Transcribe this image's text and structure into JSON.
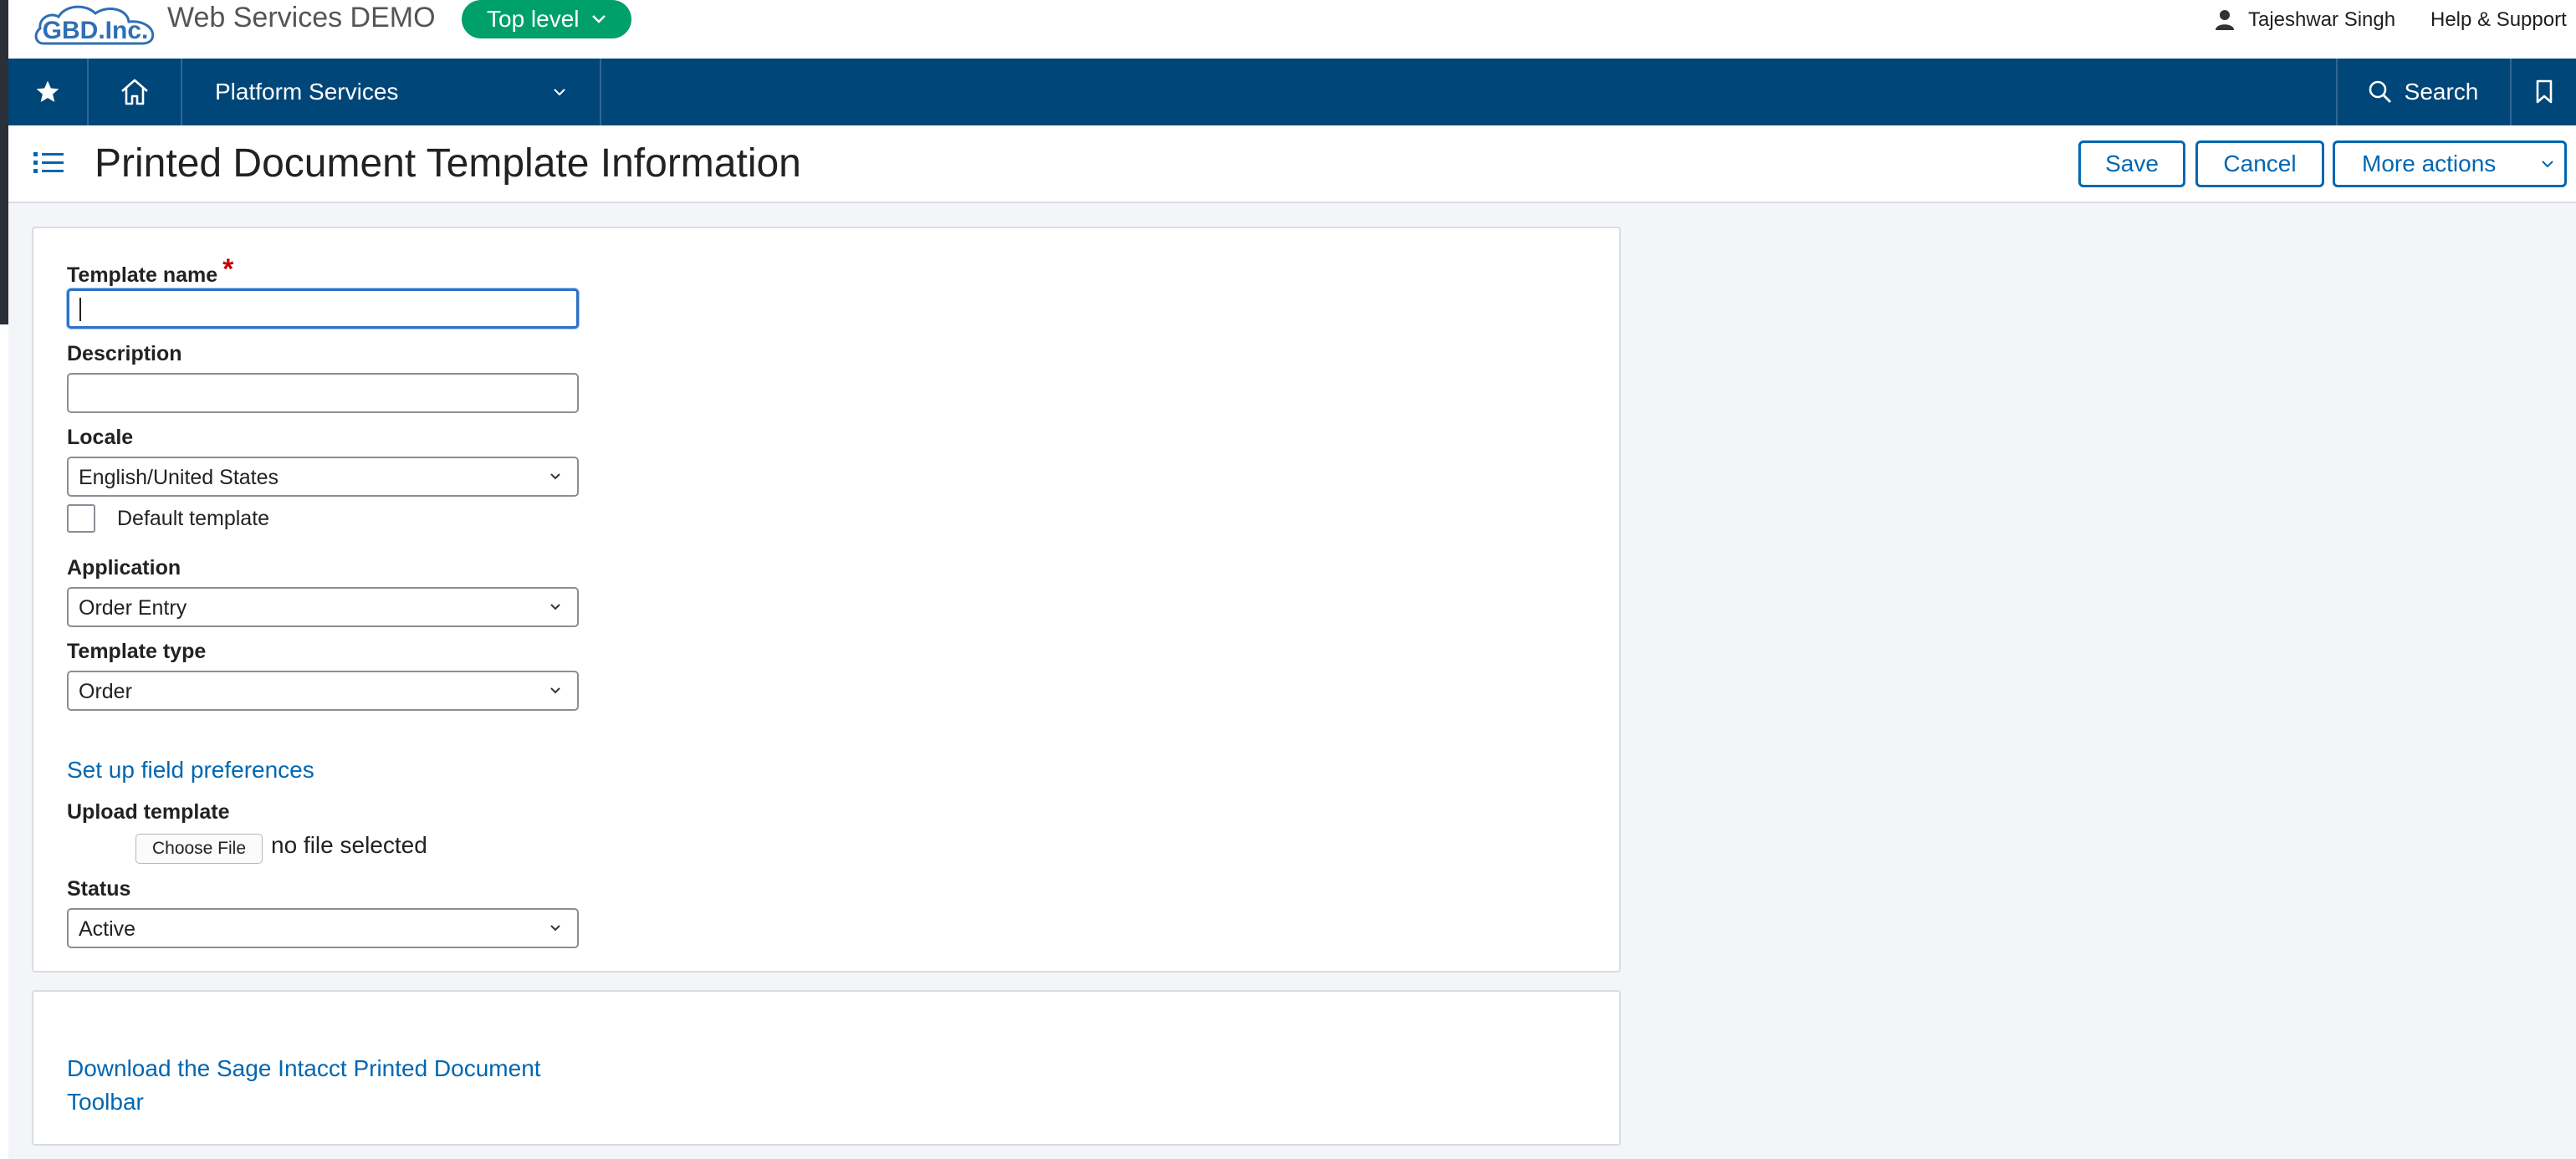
{
  "topbar": {
    "logo_text": "GBD.Inc.",
    "company_name": "Web Services DEMO",
    "level_label": "Top level",
    "user_name": "Tajeshwar Singh",
    "help_label": "Help & Support"
  },
  "nav": {
    "platform_label": "Platform Services",
    "search_label": "Search"
  },
  "header": {
    "title": "Printed Document Template Information",
    "save_label": "Save",
    "cancel_label": "Cancel",
    "more_actions_label": "More actions"
  },
  "form": {
    "template_name": {
      "label": "Template name",
      "required_mark": "*",
      "value": ""
    },
    "description": {
      "label": "Description",
      "value": ""
    },
    "locale": {
      "label": "Locale",
      "selected": "English/United States"
    },
    "default_template": {
      "label": "Default template",
      "checked": false
    },
    "application": {
      "label": "Application",
      "selected": "Order Entry"
    },
    "template_type": {
      "label": "Template type",
      "selected": "Order"
    },
    "field_prefs_link": "Set up field preferences",
    "upload": {
      "label": "Upload template",
      "button_label": "Choose File",
      "status_text": "no file selected"
    },
    "status": {
      "label": "Status",
      "selected": "Active"
    }
  },
  "download": {
    "line1": "Download the Sage Intacct Printed Document",
    "line2": "Toolbar"
  },
  "colors": {
    "nav_bg": "#004678",
    "pill_green": "#00a06b",
    "link_blue": "#0067b1"
  }
}
